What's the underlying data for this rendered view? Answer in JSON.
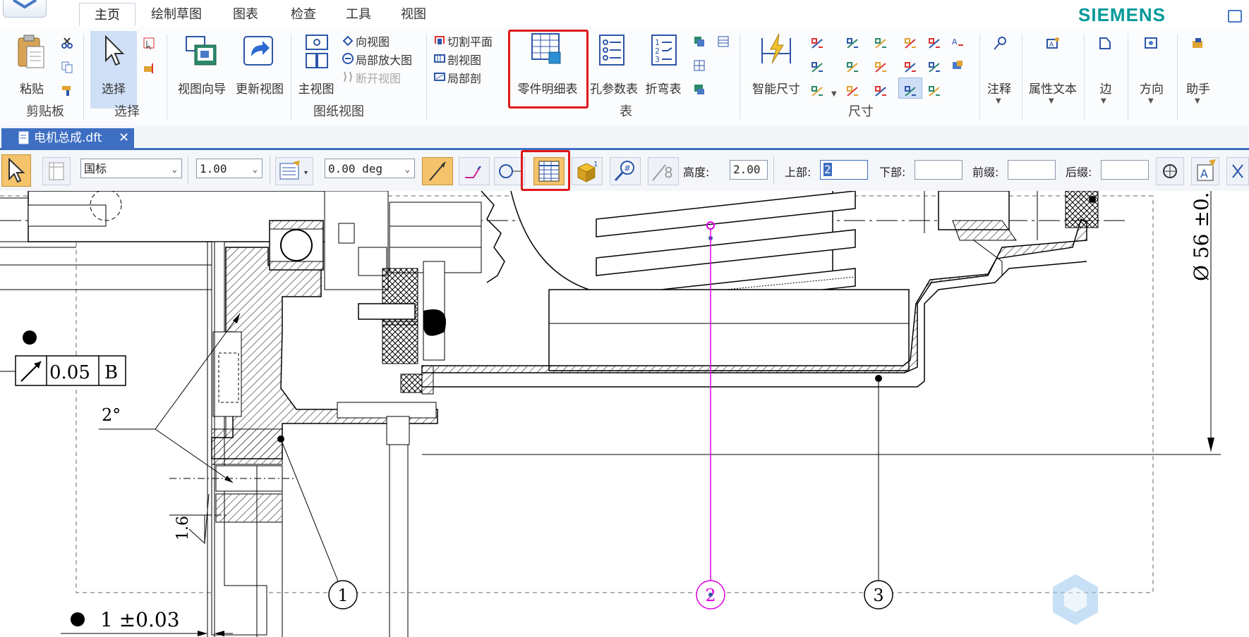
{
  "menu": {
    "tabs": [
      "主页",
      "绘制草图",
      "图表",
      "检查",
      "工具",
      "视图"
    ],
    "active_tab": "主页",
    "brand": "SIEMENS"
  },
  "ribbon": {
    "clipboard": {
      "paste_label": "粘贴",
      "group_label": "剪贴板"
    },
    "select": {
      "select_label": "选择",
      "group_label": "选择"
    },
    "views": {
      "view_wizard_label": "视图向导",
      "update_views_label": "更新视图",
      "principal_view_label": "主视图",
      "auxiliary_view_label": "向视图",
      "detail_view_label": "局部放大图",
      "broken_view_label": "断开视图",
      "cutting_plane_label": "切割平面",
      "section_view_label": "剖视图",
      "broken_out_section_label": "局部剖",
      "group_label": "图纸视图"
    },
    "tables": {
      "parts_list_label": "零件明细表",
      "hole_table_label": "孔参数表",
      "bend_table_label": "折弯表",
      "group_label": "表"
    },
    "dimensions": {
      "smart_dimension_label": "智能尺寸",
      "group_label": "尺寸"
    },
    "annotation_label": "注释",
    "property_text_label": "属性文本",
    "edge_label": "边",
    "orientation_label": "方向",
    "assistant_label": "助手"
  },
  "document_tab": {
    "title": "电机总成.dft"
  },
  "command_bar": {
    "standard": "国标",
    "scale": "1.00",
    "angle": "0.00 deg",
    "height_label": "高度:",
    "height_value": "2.00",
    "upper_label": "上部:",
    "upper_value": "2",
    "lower_label": "下部:",
    "lower_value": "",
    "prefix_label": "前缀:",
    "prefix_value": "",
    "suffix_label": "后缀:",
    "suffix_value": ""
  },
  "drawing": {
    "runout_value": "0.05",
    "datum": "B",
    "angle_note": "2°",
    "roughness": "1.6",
    "bottom_tolerance": "1 ±0.03",
    "diameter_note": "Ø 56 ±0.",
    "balloons": [
      "1",
      "2",
      "3"
    ],
    "colors": {
      "line": "#000000",
      "selection": "#e000e0",
      "highlight": "#e0191b",
      "ribbon_accent": "#3d6ec2"
    }
  }
}
